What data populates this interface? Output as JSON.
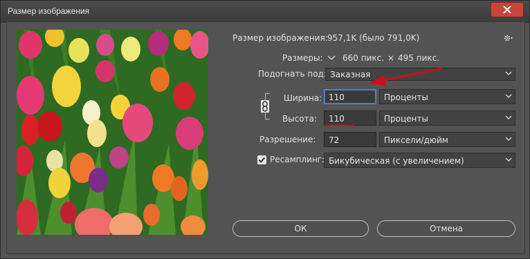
{
  "window": {
    "title": "Размер изображения"
  },
  "info": {
    "image_size_label": "Размер изображения:",
    "image_size_value": "957,1K (было 791,0K)",
    "dimensions_label": "Размеры:",
    "dimensions_width": "660 пикс.",
    "dimensions_times": "×",
    "dimensions_height": "495 пикс."
  },
  "fit": {
    "label": "Подогнать под:",
    "value": "Заказная"
  },
  "width": {
    "label": "Ширина:",
    "value": "110",
    "unit": "Проценты"
  },
  "height": {
    "label": "Высота:",
    "value": "110",
    "unit": "Проценты"
  },
  "resolution": {
    "label": "Разрешение:",
    "value": "72",
    "unit": "Пиксели/дюйм"
  },
  "resample": {
    "label": "Ресамплинг:",
    "checked": true,
    "value": "Бикубическая (с увеличением)"
  },
  "buttons": {
    "ok": "ОК",
    "cancel": "Отмена"
  },
  "icons": {
    "gear": "gear-icon",
    "chain": "chain-link-icon",
    "close": "close-icon",
    "dropdown": "chevron-down-icon",
    "check": "check-icon"
  },
  "colors": {
    "annotation_red": "#c8101a",
    "focus_blue": "#5a88c6",
    "close_red": "#c7463a"
  }
}
